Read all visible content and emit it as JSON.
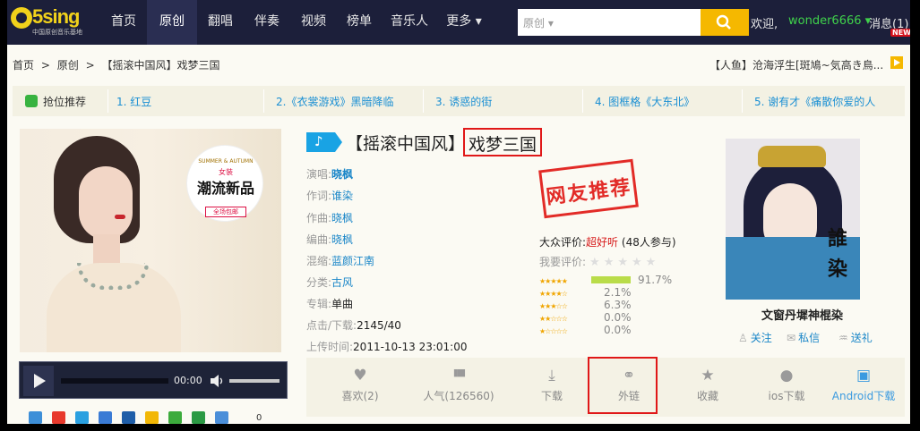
{
  "nav": {
    "logo": "5sing",
    "logo_sub": "中国原创音乐基地",
    "items": [
      "首页",
      "原创",
      "翻唱",
      "伴奏",
      "视频",
      "榜单",
      "音乐人",
      "更多 ▾"
    ],
    "active_index": 1
  },
  "search": {
    "select_label": "原创 ▾",
    "placeholder": ""
  },
  "user": {
    "welcome": "欢迎,",
    "name": "wonder6666 ▾",
    "messages": "消息(1)",
    "new_badge": "NEW"
  },
  "breadcrumb": [
    "首页",
    ">",
    "原创",
    ">",
    "【摇滚中国风】戏梦三国"
  ],
  "marquee": "【人鱼】沧海浮生[斑鳩~気高き鳥...",
  "recommend": {
    "label": "抢位推荐",
    "items": [
      "1. 红豆",
      "2.《衣裳游戏》黑暗降临",
      "3. 诱惑的街",
      "4. 图框格《大东北》",
      "5. 谢有才《痛散你爱的人"
    ]
  },
  "album": {
    "badge_line1": "SUMMER & AUTUMN",
    "badge_line2": "女装",
    "badge_line3": "潮流新品",
    "badge_line4": "全场包邮"
  },
  "player": {
    "time": "00:00"
  },
  "share": {
    "count": "0"
  },
  "song": {
    "prefix": "【摇滚中国风】",
    "name": "戏梦三国",
    "fields": [
      {
        "key": "演唱:",
        "value": "晓枫",
        "link": true
      },
      {
        "key": "作词:",
        "value": "谁染",
        "link": true
      },
      {
        "key": "作曲:",
        "value": "晓枫",
        "link": true
      },
      {
        "key": "编曲:",
        "value": "晓枫",
        "link": true
      },
      {
        "key": "混缩:",
        "value": "蓝颜江南",
        "link": true
      },
      {
        "key": "分类:",
        "value": "古风",
        "link": true
      },
      {
        "key": "专辑:",
        "value": "单曲",
        "link": false
      },
      {
        "key": "点击/下载:",
        "value": "2145/40",
        "link": false
      },
      {
        "key": "上传时间:",
        "value": "2011-10-13 23:01:00",
        "link": false
      }
    ]
  },
  "stamp": "网友推荐",
  "rating": {
    "public_label": "大众评价:",
    "public_value": "超好听",
    "public_count": "(48人参与)",
    "mine_label": "我要评价:",
    "rows": [
      {
        "stars": "★★★★★",
        "pct": "91.7%",
        "fraction": 0.917
      },
      {
        "stars": "★★★★☆",
        "pct": "2.1%",
        "fraction": 0.021
      },
      {
        "stars": "★★★☆☆",
        "pct": "6.3%",
        "fraction": 0.063
      },
      {
        "stars": "★★☆☆☆",
        "pct": "0.0%",
        "fraction": 0
      },
      {
        "stars": "★☆☆☆☆",
        "pct": "0.0%",
        "fraction": 0
      }
    ]
  },
  "artist": {
    "name": "文窗丹墀神棍染",
    "seal": "誰染",
    "follow": "关注",
    "message": "私信",
    "gift": "送礼"
  },
  "actions": [
    {
      "icon": "heart-icon",
      "glyph": "♥",
      "label": "喜欢(2)"
    },
    {
      "icon": "bar-chart-icon",
      "glyph": "▮▮▮",
      "label": "人气(126560)"
    },
    {
      "icon": "download-icon",
      "glyph": "⤓",
      "label": "下载"
    },
    {
      "icon": "link-icon",
      "glyph": "🔗",
      "label": "外链"
    },
    {
      "icon": "star-icon",
      "glyph": "★",
      "label": "收藏"
    },
    {
      "icon": "apple-icon",
      "glyph": "",
      "label": "ios下载"
    },
    {
      "icon": "android-icon",
      "glyph": "▣",
      "label": "Android下载"
    }
  ],
  "colors": {
    "nav_bg": "#1c1f3a",
    "accent": "#f5b800",
    "link": "#1a86c8",
    "highlight_box": "#e01818",
    "user_name": "#3fd24b"
  }
}
